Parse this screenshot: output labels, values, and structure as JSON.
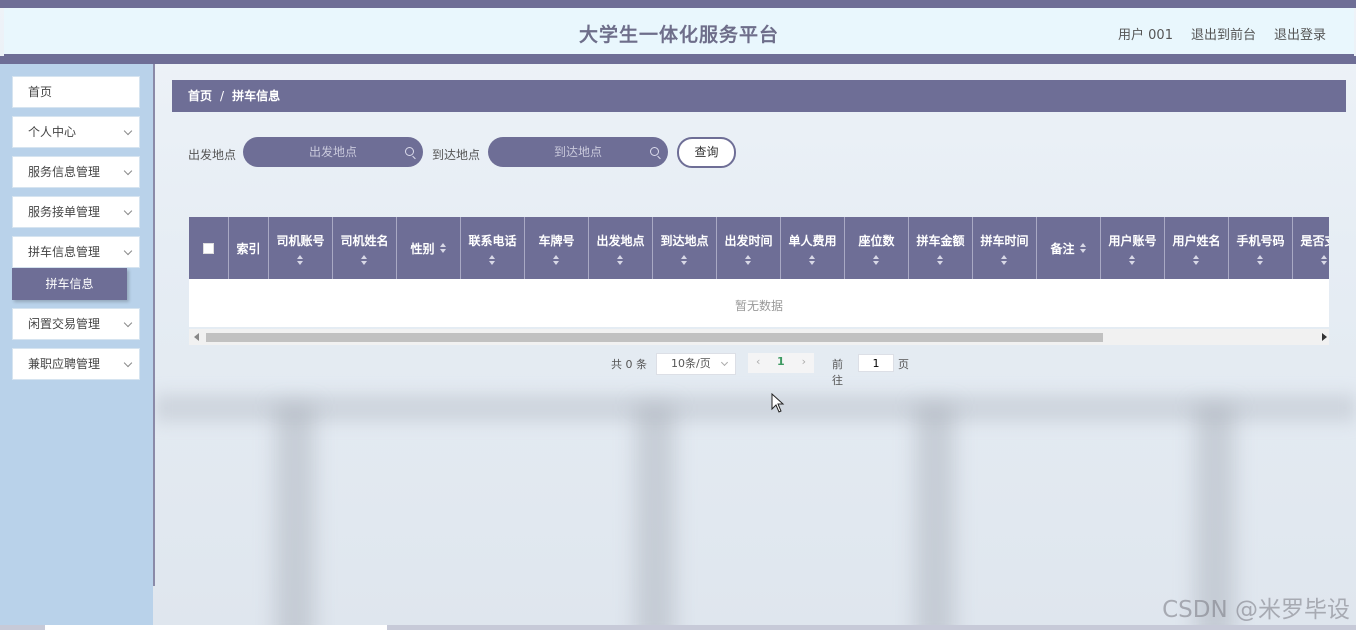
{
  "header": {
    "title": "大学生一体化服务平台",
    "user_label": "用户 001",
    "front_link": "退出到前台",
    "logout_link": "退出登录"
  },
  "sidebar": {
    "items": [
      {
        "label": "首页",
        "has_chevron": false
      },
      {
        "label": "个人中心",
        "has_chevron": true
      },
      {
        "label": "服务信息管理",
        "has_chevron": true
      },
      {
        "label": "服务接单管理",
        "has_chevron": true
      },
      {
        "label": "拼车信息管理",
        "has_chevron": true
      },
      {
        "label": "闲置交易管理",
        "has_chevron": true
      },
      {
        "label": "兼职应聘管理",
        "has_chevron": true
      }
    ],
    "active_sub": "拼车信息"
  },
  "breadcrumb": {
    "home": "首页",
    "separator": "/",
    "current": "拼车信息"
  },
  "search": {
    "from_label": "出发地点",
    "from_placeholder": "出发地点",
    "to_label": "到达地点",
    "to_placeholder": "到达地点",
    "query_button": "查询"
  },
  "table": {
    "columns": [
      {
        "label": "索引",
        "sortable": false
      },
      {
        "label": "司机账号",
        "sortable": true
      },
      {
        "label": "司机姓名",
        "sortable": true
      },
      {
        "label": "性别",
        "sortable": true
      },
      {
        "label": "联系电话",
        "sortable": true
      },
      {
        "label": "车牌号",
        "sortable": true
      },
      {
        "label": "出发地点",
        "sortable": true
      },
      {
        "label": "到达地点",
        "sortable": true
      },
      {
        "label": "出发时间",
        "sortable": true
      },
      {
        "label": "单人费用",
        "sortable": true
      },
      {
        "label": "座位数",
        "sortable": true
      },
      {
        "label": "拼车金额",
        "sortable": true
      },
      {
        "label": "拼车时间",
        "sortable": true
      },
      {
        "label": "备注",
        "sortable": true
      },
      {
        "label": "用户账号",
        "sortable": true
      },
      {
        "label": "用户姓名",
        "sortable": true
      },
      {
        "label": "手机号码",
        "sortable": true
      },
      {
        "label": "是否支付",
        "sortable": true
      }
    ],
    "empty_text": "暂无数据"
  },
  "pagination": {
    "total": "共 0 条",
    "page_size": "10条/页",
    "current_page": "1",
    "prev_symbol": "‹",
    "next_symbol": "›",
    "goto_label": "前往",
    "goto_value": "1",
    "page_suffix": "页"
  },
  "watermark": "CSDN @米罗毕设",
  "colors": {
    "accent": "#6e6e96",
    "sidebar_bg": "#b9d2ea",
    "header_bg": "#e9f7fd",
    "active_page": "#3e9a62"
  }
}
